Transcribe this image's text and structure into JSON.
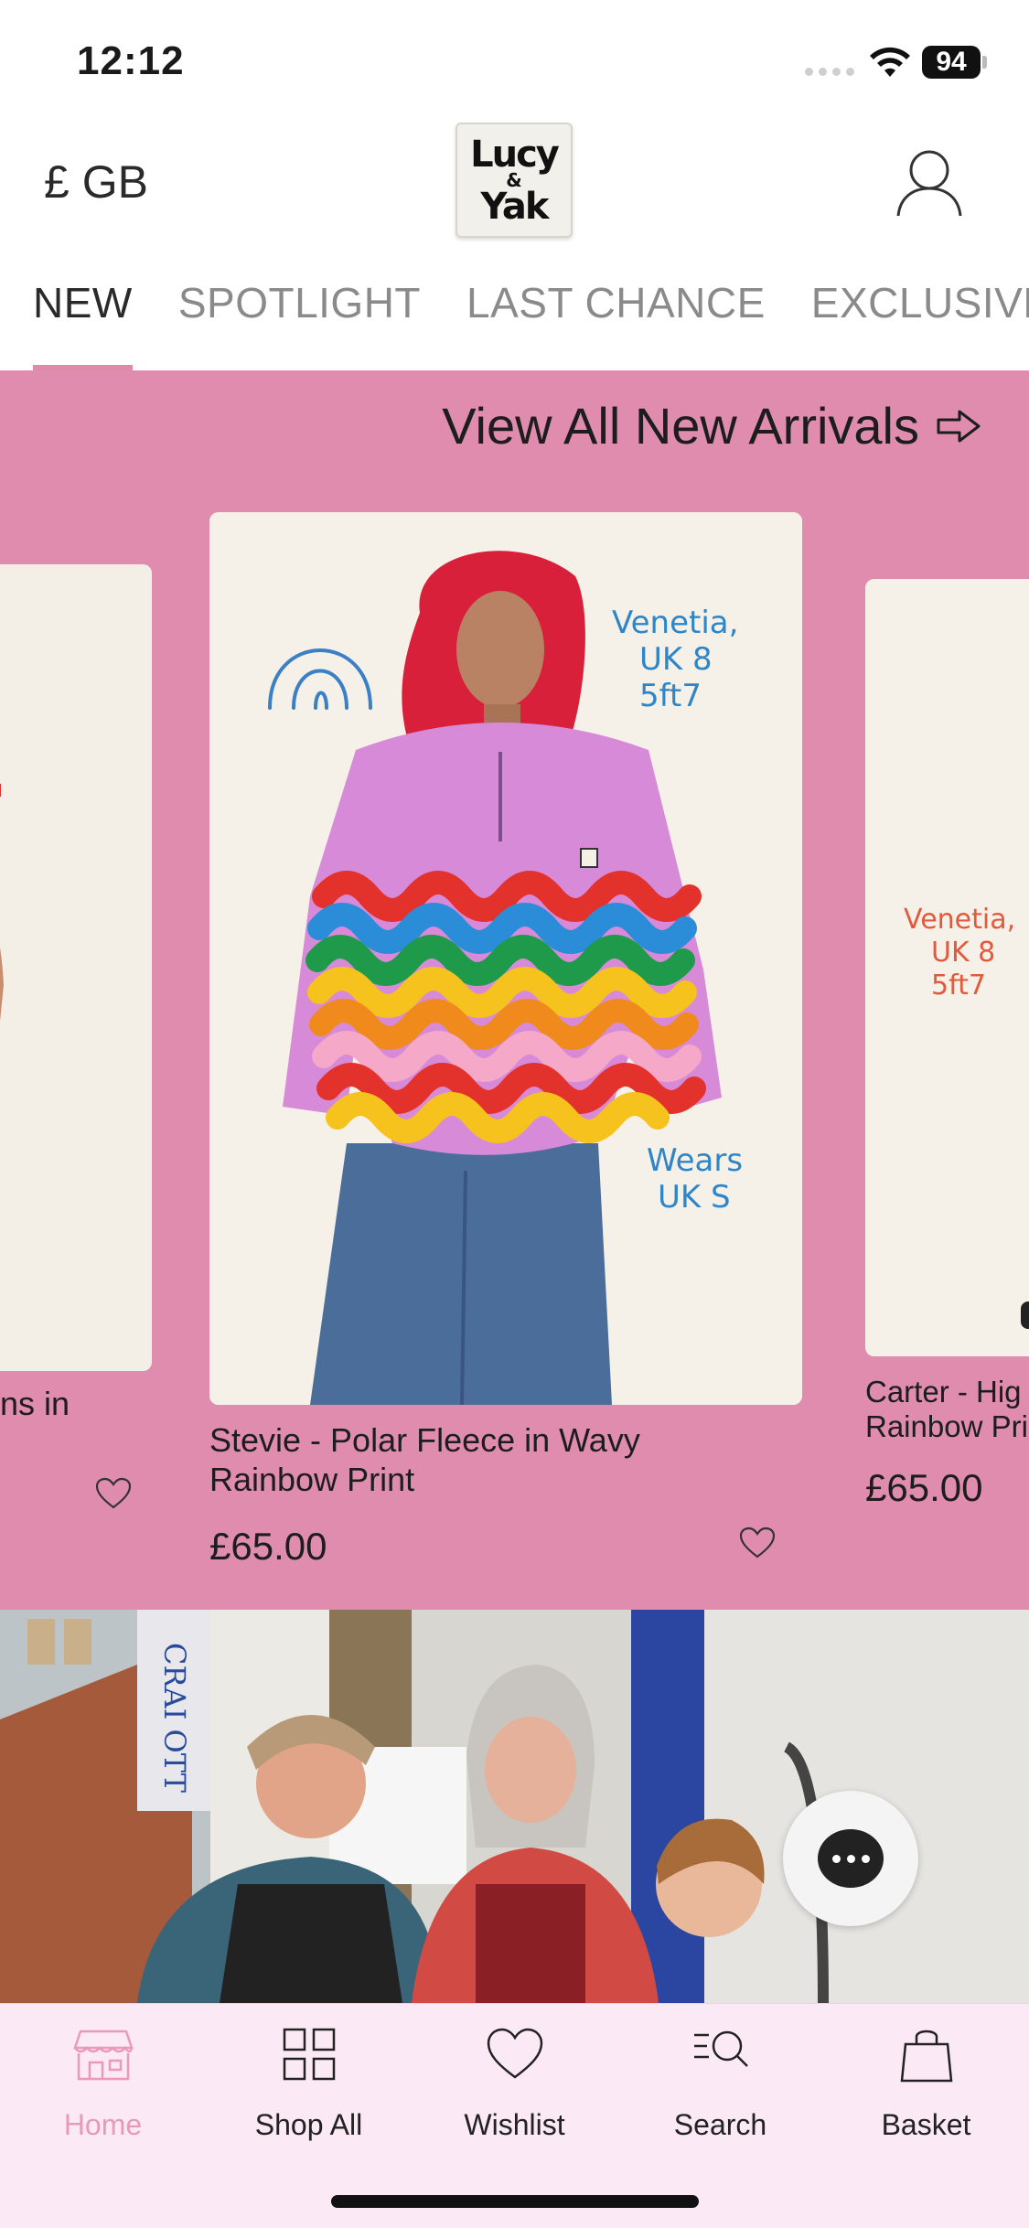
{
  "status_bar": {
    "time": "12:12",
    "battery": "94"
  },
  "header": {
    "currency": "£ GB",
    "logo": {
      "line1": "Lucy",
      "line2": "&",
      "line3": "Yak"
    }
  },
  "tabs": [
    {
      "label": "NEW",
      "active": true
    },
    {
      "label": "SPOTLIGHT",
      "active": false
    },
    {
      "label": "LAST CHANCE",
      "active": false
    },
    {
      "label": "EXCLUSIVE",
      "active": false
    }
  ],
  "new_arrivals": {
    "view_all_label": "View All New Arrivals",
    "accent_color": "#df8cae",
    "products": [
      {
        "title_fragment": "ns in",
        "price": ""
      },
      {
        "title": "Stevie - Polar Fleece in Wavy Rainbow Print",
        "price": "£65.00",
        "overlay_model": [
          "Venetia,",
          "UK 8",
          "5ft7"
        ],
        "overlay_size": [
          "Wears",
          "UK S"
        ]
      },
      {
        "title": "Carter - Hig Rainbow Pri",
        "price": "£65.00",
        "overlay_model": [
          "Venetia,",
          "UK 8",
          "5ft7"
        ]
      }
    ]
  },
  "banner": {
    "sign_text": "CRAI OTT",
    "sign_vertical": "OTTERY"
  },
  "bottom_nav": [
    {
      "label": "Home",
      "icon": "home-icon",
      "active": true
    },
    {
      "label": "Shop All",
      "icon": "grid-icon",
      "active": false
    },
    {
      "label": "Wishlist",
      "icon": "heart-icon",
      "active": false
    },
    {
      "label": "Search",
      "icon": "search-icon",
      "active": false
    },
    {
      "label": "Basket",
      "icon": "basket-icon",
      "active": false
    }
  ]
}
